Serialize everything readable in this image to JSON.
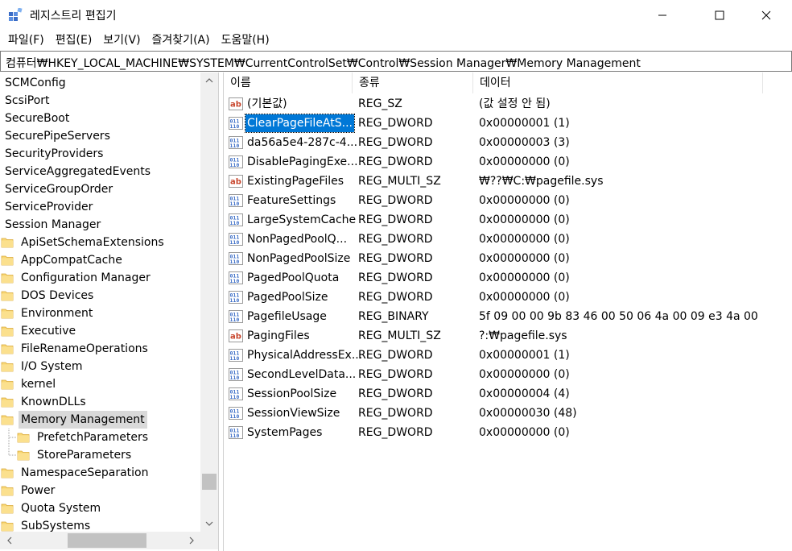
{
  "window": {
    "title": "레지스트리 편집기",
    "minimize_glyph": "—",
    "maximize_glyph": "☐",
    "close_glyph": "✕"
  },
  "menu": [
    "파일(F)",
    "편집(E)",
    "보기(V)",
    "즐겨찾기(A)",
    "도움말(H)"
  ],
  "address": "컴퓨터₩HKEY_LOCAL_MACHINE₩SYSTEM₩CurrentControlSet₩Control₩Session Manager₩Memory Management",
  "tree": {
    "items": [
      {
        "label": "SCMConfig",
        "level": 0,
        "folder": false
      },
      {
        "label": "ScsiPort",
        "level": 0,
        "folder": false
      },
      {
        "label": "SecureBoot",
        "level": 0,
        "folder": false
      },
      {
        "label": "SecurePipeServers",
        "level": 0,
        "folder": false
      },
      {
        "label": "SecurityProviders",
        "level": 0,
        "folder": false
      },
      {
        "label": "ServiceAggregatedEvents",
        "level": 0,
        "folder": false
      },
      {
        "label": "ServiceGroupOrder",
        "level": 0,
        "folder": false
      },
      {
        "label": "ServiceProvider",
        "level": 0,
        "folder": false
      },
      {
        "label": "Session Manager",
        "level": 0,
        "folder": false
      },
      {
        "label": "ApiSetSchemaExtensions",
        "level": 1,
        "folder": true
      },
      {
        "label": "AppCompatCache",
        "level": 1,
        "folder": true
      },
      {
        "label": "Configuration Manager",
        "level": 1,
        "folder": true
      },
      {
        "label": "DOS Devices",
        "level": 1,
        "folder": true
      },
      {
        "label": "Environment",
        "level": 1,
        "folder": true
      },
      {
        "label": "Executive",
        "level": 1,
        "folder": true
      },
      {
        "label": "FileRenameOperations",
        "level": 1,
        "folder": true
      },
      {
        "label": "I/O System",
        "level": 1,
        "folder": true
      },
      {
        "label": "kernel",
        "level": 1,
        "folder": true
      },
      {
        "label": "KnownDLLs",
        "level": 1,
        "folder": true
      },
      {
        "label": "Memory Management",
        "level": 1,
        "folder": true,
        "selected": true
      },
      {
        "label": "PrefetchParameters",
        "level": 2,
        "folder": true
      },
      {
        "label": "StoreParameters",
        "level": 2,
        "folder": true
      },
      {
        "label": "NamespaceSeparation",
        "level": 1,
        "folder": true
      },
      {
        "label": "Power",
        "level": 1,
        "folder": true
      },
      {
        "label": "Quota System",
        "level": 1,
        "folder": true
      },
      {
        "label": "SubSystems",
        "level": 1,
        "folder": true
      }
    ]
  },
  "columns": [
    "이름",
    "종류",
    "데이터"
  ],
  "values": [
    {
      "icon": "string-value-icon",
      "name": "(기본값)",
      "type": "REG_SZ",
      "data": "(값 설정 안 됨)"
    },
    {
      "icon": "binary-value-icon",
      "name": "ClearPageFileAtS...",
      "type": "REG_DWORD",
      "data": "0x00000001 (1)",
      "selected": true
    },
    {
      "icon": "binary-value-icon",
      "name": "da56a5e4-287c-4...",
      "type": "REG_DWORD",
      "data": "0x00000003 (3)"
    },
    {
      "icon": "binary-value-icon",
      "name": "DisablePagingExe...",
      "type": "REG_DWORD",
      "data": "0x00000000 (0)"
    },
    {
      "icon": "string-value-icon",
      "name": "ExistingPageFiles",
      "type": "REG_MULTI_SZ",
      "data": "₩??₩C:₩pagefile.sys"
    },
    {
      "icon": "binary-value-icon",
      "name": "FeatureSettings",
      "type": "REG_DWORD",
      "data": "0x00000000 (0)"
    },
    {
      "icon": "binary-value-icon",
      "name": "LargeSystemCache",
      "type": "REG_DWORD",
      "data": "0x00000000 (0)"
    },
    {
      "icon": "binary-value-icon",
      "name": "NonPagedPoolQ...",
      "type": "REG_DWORD",
      "data": "0x00000000 (0)"
    },
    {
      "icon": "binary-value-icon",
      "name": "NonPagedPoolSize",
      "type": "REG_DWORD",
      "data": "0x00000000 (0)"
    },
    {
      "icon": "binary-value-icon",
      "name": "PagedPoolQuota",
      "type": "REG_DWORD",
      "data": "0x00000000 (0)"
    },
    {
      "icon": "binary-value-icon",
      "name": "PagedPoolSize",
      "type": "REG_DWORD",
      "data": "0x00000000 (0)"
    },
    {
      "icon": "binary-value-icon",
      "name": "PagefileUsage",
      "type": "REG_BINARY",
      "data": "5f 09 00 00 9b 83 46 00 50 06 4a 00 09 e3 4a 00 ..."
    },
    {
      "icon": "string-value-icon",
      "name": "PagingFiles",
      "type": "REG_MULTI_SZ",
      "data": "?:₩pagefile.sys"
    },
    {
      "icon": "binary-value-icon",
      "name": "PhysicalAddressEx...",
      "type": "REG_DWORD",
      "data": "0x00000001 (1)"
    },
    {
      "icon": "binary-value-icon",
      "name": "SecondLevelData...",
      "type": "REG_DWORD",
      "data": "0x00000000 (0)"
    },
    {
      "icon": "binary-value-icon",
      "name": "SessionPoolSize",
      "type": "REG_DWORD",
      "data": "0x00000004 (4)"
    },
    {
      "icon": "binary-value-icon",
      "name": "SessionViewSize",
      "type": "REG_DWORD",
      "data": "0x00000030 (48)"
    },
    {
      "icon": "binary-value-icon",
      "name": "SystemPages",
      "type": "REG_DWORD",
      "data": "0x00000000 (0)"
    }
  ],
  "colors": {
    "selection_blue": "#0078d7",
    "tree_selected_gray": "#d9d9d9",
    "folder_yellow": "#f8d775",
    "string_icon_red": "#c8462d",
    "binary_icon_blue": "#3a6cc6"
  }
}
